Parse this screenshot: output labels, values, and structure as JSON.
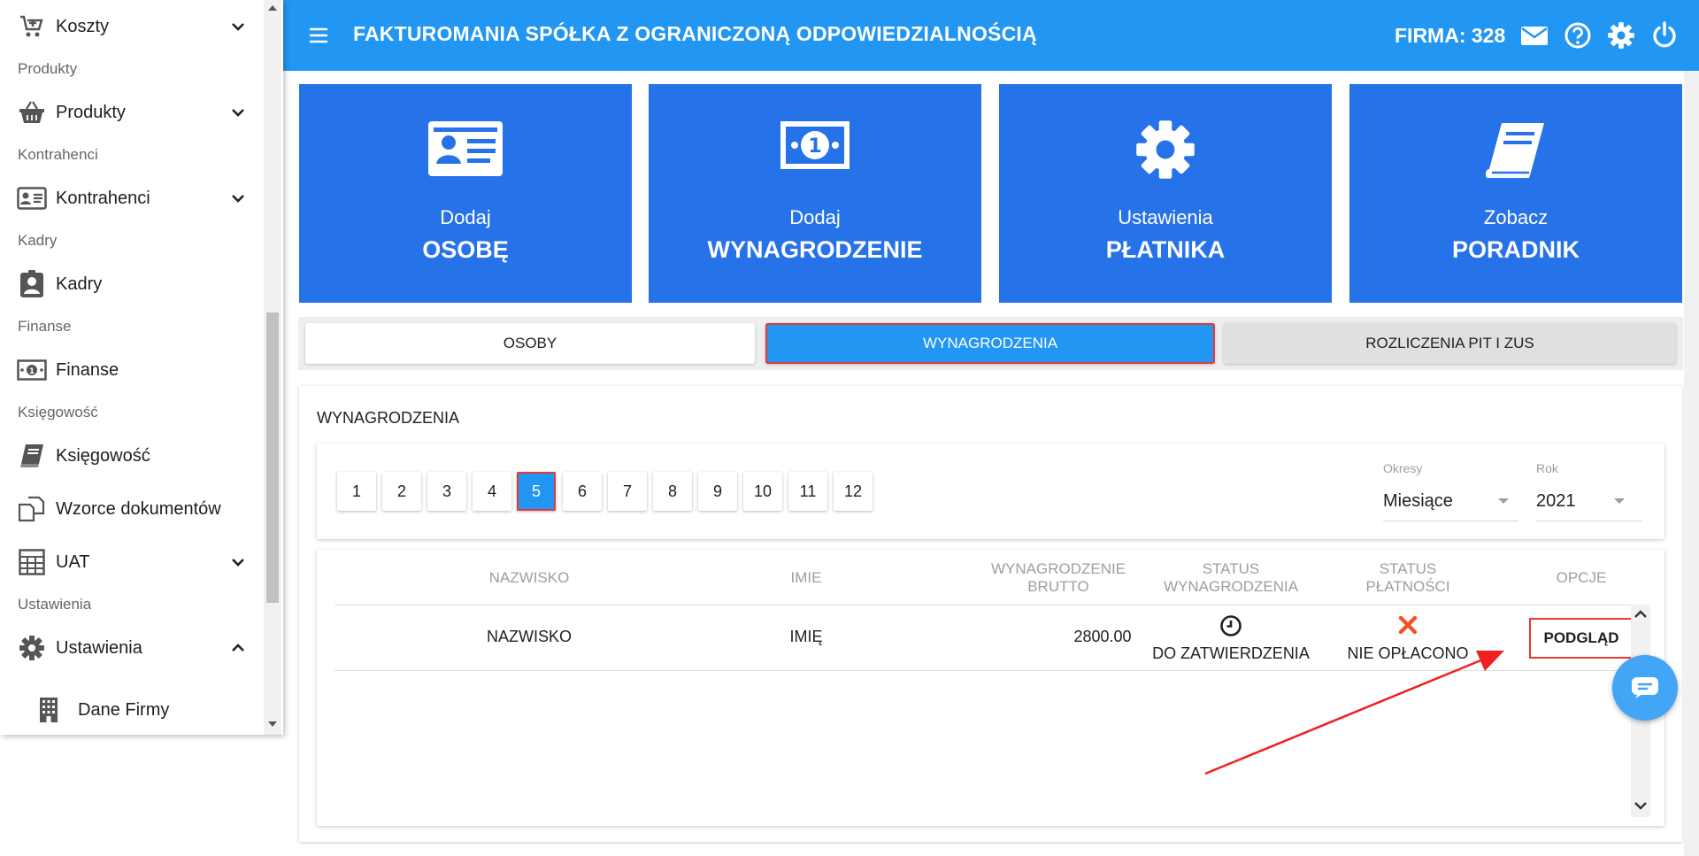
{
  "sidebar": {
    "sections": {
      "produkty": "Produkty",
      "kontrahenci": "Kontrahenci",
      "kadry": "Kadry",
      "finanse": "Finanse",
      "ksiegowosc": "Księgowość",
      "ustawienia": "Ustawienia"
    },
    "items": {
      "koszty": "Koszty",
      "produkty": "Produkty",
      "kontrahenci": "Kontrahenci",
      "kadry": "Kadry",
      "finanse": "Finanse",
      "ksiegowosc": "Księgowość",
      "wzorce": "Wzorce dokumentów",
      "uat": "UAT",
      "ustawienia": "Ustawienia",
      "dane_firmy": "Dane Firmy"
    }
  },
  "header": {
    "company": "FAKTUROMANIA SPÓŁKA Z OGRANICZONĄ ODPOWIEDZIALNOŚCIĄ",
    "firma": "FIRMA: 328",
    "color": "#2196f3"
  },
  "tiles": [
    {
      "small": "Dodaj",
      "big": "OSOBĘ",
      "icon": "id-card-icon"
    },
    {
      "small": "Dodaj",
      "big": "WYNAGRODZENIE",
      "icon": "banknote-icon"
    },
    {
      "small": "Ustawienia",
      "big": "PŁATNIKA",
      "icon": "gear-icon"
    },
    {
      "small": "Zobacz",
      "big": "PORADNIK",
      "icon": "book-icon"
    }
  ],
  "tabs": {
    "osoby": "OSOBY",
    "wynagrodzenia": "WYNAGRODZENIA",
    "pit": "ROZLICZENIA PIT I ZUS"
  },
  "panel": {
    "title": "WYNAGRODZENIA",
    "pages": [
      "1",
      "2",
      "3",
      "4",
      "5",
      "6",
      "7",
      "8",
      "9",
      "10",
      "11",
      "12"
    ],
    "active_page": "5",
    "okresy": {
      "label": "Okresy",
      "value": "Miesiące"
    },
    "rok": {
      "label": "Rok",
      "value": "2021"
    }
  },
  "table": {
    "headers": {
      "nazwisko": "NAZWISKO",
      "imie": "IMIE",
      "brutto_1": "WYNAGRODZENIE",
      "brutto_2": "BRUTTO",
      "status_wyn_1": "STATUS",
      "status_wyn_2": "WYNAGRODZENIA",
      "status_pl_1": "STATUS",
      "status_pl_2": "PŁATNOŚCI",
      "opcje": "OPCJE"
    },
    "rows": [
      {
        "nazwisko": "NAZWISKO",
        "imie": "IMIĘ",
        "brutto": "2800.00",
        "status_wyn": "DO ZATWIERDZENIA",
        "status_pl": "NIE OPŁACONO",
        "action": "PODGLĄD"
      }
    ]
  }
}
